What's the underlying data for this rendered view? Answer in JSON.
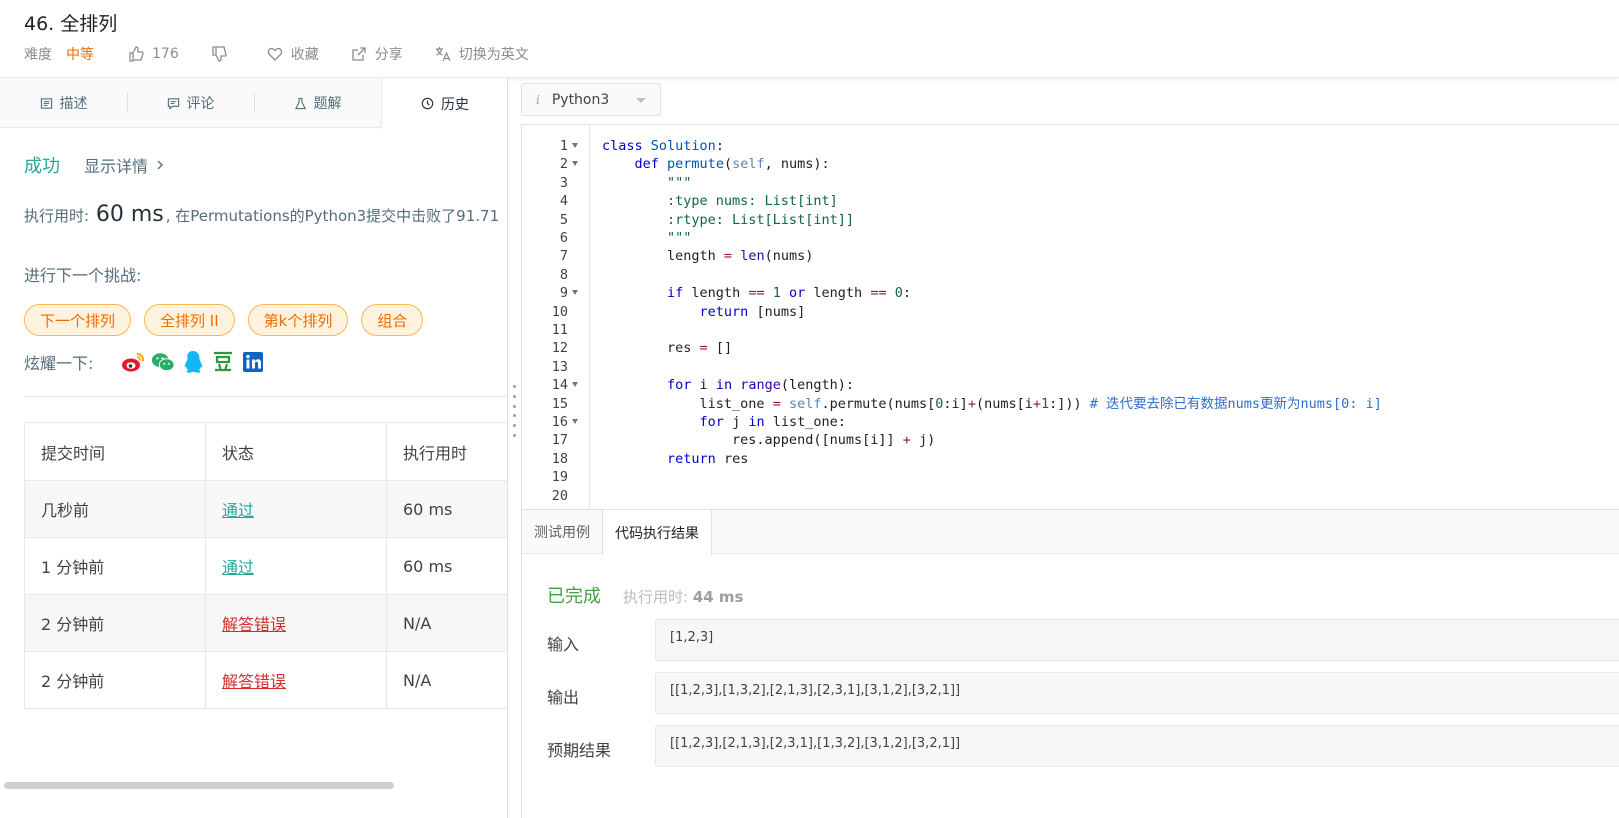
{
  "problem": {
    "title": "46. 全排列",
    "difficulty_label": "难度",
    "difficulty": "中等",
    "likes": "176",
    "favorite": "收藏",
    "share": "分享",
    "switch_lang": "切换为英文"
  },
  "left_tabs": [
    "描述",
    "评论",
    "题解",
    "历史"
  ],
  "submission": {
    "status": "成功",
    "details": "显示详情",
    "runtime_prefix": "执行用时: ",
    "runtime_value": "60 ms",
    "runtime_suffix": ", 在Permutations的Python3提交中击败了91.71",
    "next_challenge": "进行下一个挑战:",
    "challenges": [
      "下一个排列",
      "全排列 II",
      "第k个排列",
      "组合"
    ],
    "share_label": "炫耀一下:"
  },
  "history": {
    "headers": [
      "提交时间",
      "状态",
      "执行用时"
    ],
    "rows": [
      {
        "time": "几秒前",
        "status": "通过",
        "runtime": "60 ms"
      },
      {
        "time": "1 分钟前",
        "status": "通过",
        "runtime": "60 ms"
      },
      {
        "time": "2 分钟前",
        "status": "解答错误",
        "runtime": "N/A"
      },
      {
        "time": "2 分钟前",
        "status": "解答错误",
        "runtime": "N/A"
      }
    ]
  },
  "editor": {
    "language": "Python3",
    "line_numbers": [
      "1",
      "2",
      "3",
      "4",
      "5",
      "6",
      "7",
      "8",
      "9",
      "10",
      "11",
      "12",
      "13",
      "14",
      "15",
      "16",
      "17",
      "18",
      "19",
      "20"
    ]
  },
  "result_tabs": [
    "测试用例",
    "代码执行结果"
  ],
  "result": {
    "status": "已完成",
    "runtime_label": "执行用时: ",
    "runtime_value": "44 ms",
    "input_label": "输入",
    "input": "[1,2,3]",
    "output_label": "输出",
    "output": "[[1,2,3],[1,3,2],[2,1,3],[2,3,1],[3,1,2],[3,2,1]]",
    "expected_label": "预期结果",
    "expected": "[[1,2,3],[2,1,3],[2,3,1],[1,3,2],[3,1,2],[3,2,1]]"
  },
  "colors": {
    "accent": "#26a69a",
    "warning": "#ef6c00",
    "error": "#d32f2f",
    "done": "#43a047"
  }
}
